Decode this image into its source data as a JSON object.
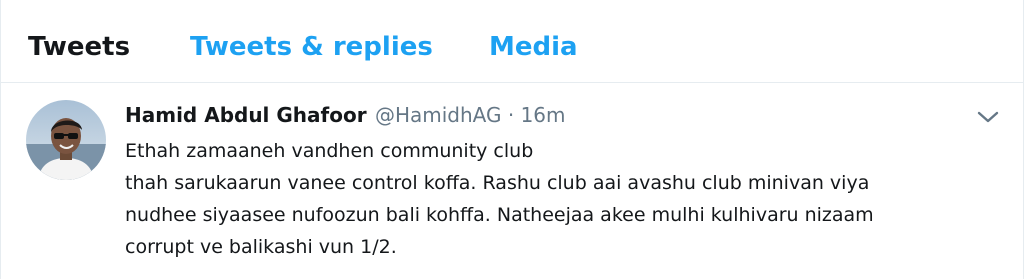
{
  "tabs": [
    {
      "label": "Tweets",
      "active": true
    },
    {
      "label": "Tweets & replies",
      "active": false
    },
    {
      "label": "Media",
      "active": false
    }
  ],
  "tweet": {
    "author_name": "Hamid Abdul Ghafoor",
    "handle": "@HamidhAG",
    "separator": "·",
    "time": "16m",
    "text_lines": [
      "Ethah zamaaneh vandhen community club",
      "thah sarukaarun vanee control koffa. Rashu club aai avashu club minivan viya",
      "nudhee siyaasee nufoozun bali kohffa. Natheejaa akee mulhi kulhivaru nizaam",
      "corrupt ve balikashi vun 1/2."
    ],
    "menu_icon": "chevron-down-icon"
  },
  "colors": {
    "accent": "#1da1f2",
    "text_primary": "#14171a",
    "text_secondary": "#657786",
    "border": "#e6ecf0"
  }
}
